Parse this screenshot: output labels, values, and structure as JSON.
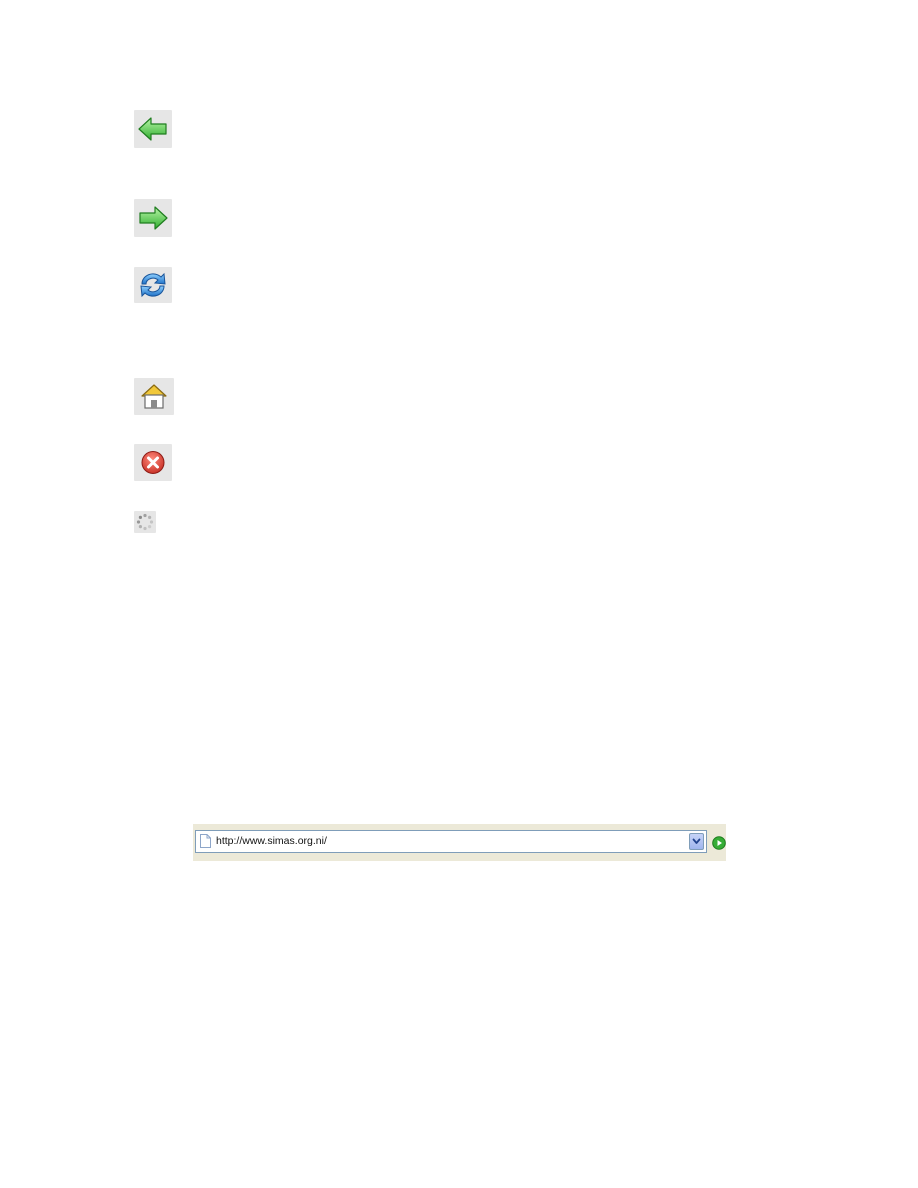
{
  "toolbar": {
    "back": {
      "icon": "back-arrow-icon",
      "color": "#3dbb3d"
    },
    "forward": {
      "icon": "forward-arrow-icon",
      "color": "#3dbb3d"
    },
    "refresh": {
      "icon": "refresh-icon",
      "color": "#2e8fd8"
    },
    "home": {
      "icon": "home-icon",
      "color": "#e8c33c"
    },
    "stop": {
      "icon": "stop-icon",
      "color": "#d63a32"
    },
    "loading": {
      "icon": "loading-spinner-icon",
      "color": "#9a9a9a"
    }
  },
  "address_bar": {
    "url": "http://www.simas.org.ni/",
    "page_icon": "page-icon",
    "dropdown_icon": "chevron-down-icon",
    "go_icon": "go-arrow-icon",
    "go_color": "#2fa82f"
  }
}
